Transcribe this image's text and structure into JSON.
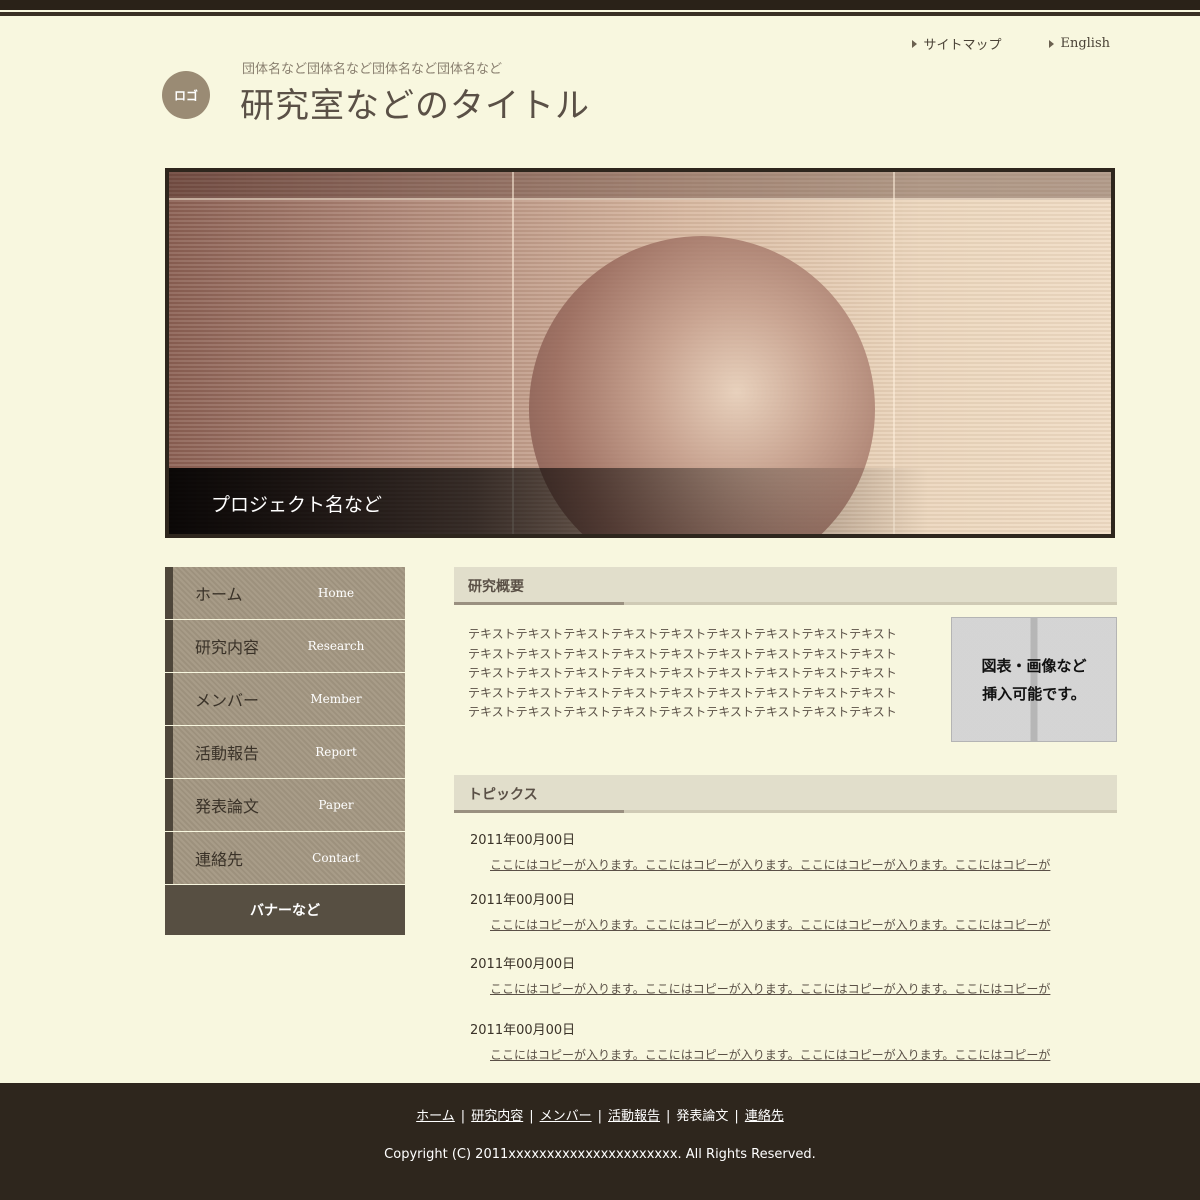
{
  "header": {
    "utility_links": [
      {
        "label": "サイトマップ"
      },
      {
        "label": "English"
      }
    ],
    "logo_text": "ロゴ",
    "org_name": "団体名など団体名など団体名など団体名など",
    "site_title": "研究室などのタイトル"
  },
  "hero": {
    "caption": "プロジェクト名など"
  },
  "sidebar": {
    "items": [
      {
        "jp": "ホーム",
        "en": "Home"
      },
      {
        "jp": "研究内容",
        "en": "Research"
      },
      {
        "jp": "メンバー",
        "en": "Member"
      },
      {
        "jp": "活動報告",
        "en": "Report"
      },
      {
        "jp": "発表論文",
        "en": "Paper"
      },
      {
        "jp": "連絡先",
        "en": "Contact"
      }
    ],
    "banner": "バナーなど"
  },
  "overview": {
    "title": "研究概要",
    "lines": [
      "テキストテキストテキストテキストテキストテキストテキストテキストテキスト",
      "テキストテキストテキストテキストテキストテキストテキストテキストテキスト",
      "テキストテキストテキストテキストテキストテキストテキストテキストテキスト",
      "テキストテキストテキストテキストテキストテキストテキストテキストテキスト",
      "テキストテキストテキストテキストテキストテキストテキストテキストテキスト"
    ],
    "figure_lines": [
      "図表・画像など",
      "挿入可能です。"
    ]
  },
  "topics": {
    "title": "トピックス",
    "items": [
      {
        "date": "2011年00月00日",
        "text": "ここにはコピーが入ります。ここにはコピーが入ります。ここにはコピーが入ります。ここにはコピーが"
      },
      {
        "date": "2011年00月00日",
        "text": "ここにはコピーが入ります。ここにはコピーが入ります。ここにはコピーが入ります。ここにはコピーが"
      },
      {
        "date": "2011年00月00日",
        "text": "ここにはコピーが入ります。ここにはコピーが入ります。ここにはコピーが入ります。ここにはコピーが"
      },
      {
        "date": "2011年00月00日",
        "text": "ここにはコピーが入ります。ここにはコピーが入ります。ここにはコピーが入ります。ここにはコピーが"
      }
    ]
  },
  "footer": {
    "links": [
      {
        "label": "ホーム"
      },
      {
        "label": "研究内容"
      },
      {
        "label": "メンバー"
      },
      {
        "label": "活動報告"
      },
      {
        "label": "発表論文"
      },
      {
        "label": "連絡先"
      }
    ],
    "separator": "|",
    "copyright": "Copyright (C) 2011xxxxxxxxxxxxxxxxxxxxxx. All Rights Reserved."
  }
}
